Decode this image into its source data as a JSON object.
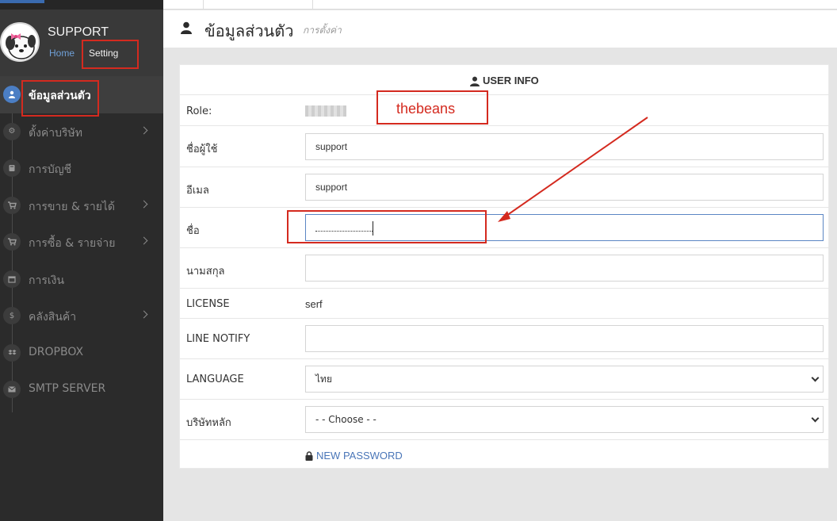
{
  "app": {
    "user_name": "SUPPORT",
    "breadcrumb": {
      "home": "Home",
      "current": "Setting"
    }
  },
  "sidebar": {
    "items": [
      {
        "label": "ข้อมูลส่วนตัว",
        "icon": "user-icon",
        "active": true,
        "has_submenu": false
      },
      {
        "label": "ตั้งค่าบริษัท",
        "icon": "gear-icon",
        "active": false,
        "has_submenu": true
      },
      {
        "label": "การบัญชี",
        "icon": "book-icon",
        "active": false,
        "has_submenu": false
      },
      {
        "label": "การขาย & รายได้",
        "icon": "cart-icon",
        "active": false,
        "has_submenu": true
      },
      {
        "label": "การซื้อ & รายจ่าย",
        "icon": "cart-icon",
        "active": false,
        "has_submenu": true
      },
      {
        "label": "การเงิน",
        "icon": "calendar-icon",
        "active": false,
        "has_submenu": false
      },
      {
        "label": "คลังสินค้า",
        "icon": "dollar-icon",
        "active": false,
        "has_submenu": true
      },
      {
        "label": "DROPBOX",
        "icon": "dropbox-icon",
        "active": false,
        "has_submenu": false
      },
      {
        "label": "SMTP SERVER",
        "icon": "envelope-icon",
        "active": false,
        "has_submenu": false
      }
    ]
  },
  "page": {
    "title": "ข้อมูลส่วนตัว",
    "subtitle": "การตั้งค่า"
  },
  "panel": {
    "heading": "USER INFO",
    "role_label": "Role:",
    "username_label": "ชื่อผู้ใช้",
    "username_value": "support",
    "email_label": "อีเมล",
    "email_value": "support",
    "firstname_label": "ชื่อ",
    "firstname_value": "",
    "lastname_label": "นามสกุล",
    "lastname_value": "",
    "license_label": "LICENSE",
    "license_value": "serf",
    "line_notify_label": "LINE NOTIFY",
    "line_notify_value": "",
    "language_label": "LANGUAGE",
    "language_selected": "ไทย",
    "company_label": "บริษัทหลัก",
    "company_selected": "- - Choose - -",
    "new_password": "NEW PASSWORD"
  },
  "annotations": {
    "note_text": "thebeans",
    "color": "#d42a1f"
  },
  "colors": {
    "accent": "#4b7ec4",
    "link": "#4a76b8",
    "sidebar_bg": "#2b2b2b"
  }
}
